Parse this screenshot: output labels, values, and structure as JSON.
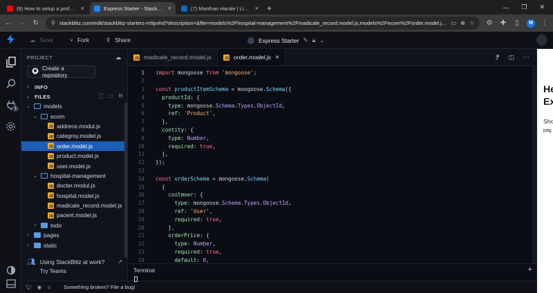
{
  "browser": {
    "tabs": [
      {
        "title": "(8) How to setup a professional",
        "favicon": "youtube-icon",
        "color": "#ff0000",
        "active": false
      },
      {
        "title": "Express Starter - StackBlitz",
        "favicon": "stackblitz-icon",
        "color": "#1389fd",
        "active": true
      },
      {
        "title": "(7) Manthan Harale | LinkedIn",
        "favicon": "linkedin-icon",
        "color": "#0a66c2",
        "active": false
      }
    ],
    "new_tab": "+",
    "url": "stackblitz.com/edit/stackblitz-starters-m9pvhd?description=&file=models%2Fhospital-management%2Fmadicale_record.model.js,models%2Fecom%2Forder.model.j...",
    "profile_initial": "M"
  },
  "header": {
    "save_label": "Save",
    "fork_label": "Fork",
    "share_label": "Share",
    "project_name": "Express Starter"
  },
  "sidebar": {
    "project_label": "PROJECT",
    "create_repo_label": "Create a repository",
    "info_label": "INFO",
    "files_label": "FILES",
    "tree": [
      {
        "label": "models",
        "type": "folder-open",
        "depth": 0
      },
      {
        "label": "ecom",
        "type": "folder-open",
        "depth": 1
      },
      {
        "label": "addrece.modul.js",
        "type": "file",
        "depth": 2
      },
      {
        "label": "categroy.model.js",
        "type": "file",
        "depth": 2
      },
      {
        "label": "order.model.js",
        "type": "file",
        "depth": 2,
        "selected": true
      },
      {
        "label": "product.model.js",
        "type": "file",
        "depth": 2
      },
      {
        "label": "user.model.js",
        "type": "file",
        "depth": 2
      },
      {
        "label": "hospital-management",
        "type": "folder-open",
        "depth": 1
      },
      {
        "label": "docter.modul.js",
        "type": "file",
        "depth": 2
      },
      {
        "label": "hospital.model.js",
        "type": "file",
        "depth": 2
      },
      {
        "label": "madicale_record.model.js",
        "type": "file",
        "depth": 2
      },
      {
        "label": "pacent.model.js",
        "type": "file",
        "depth": 2
      },
      {
        "label": "todo",
        "type": "folder-closed",
        "depth": 1
      },
      {
        "label": "pages",
        "type": "folder-closed",
        "depth": 0
      },
      {
        "label": "static",
        "type": "folder-closed",
        "depth": 0
      }
    ],
    "promo_line1": "Using StackBlitz at work?",
    "promo_line2": "Try Teams"
  },
  "activity": {
    "ports_badge": "1"
  },
  "status": {
    "broken_label": "Something broken? File a bug!"
  },
  "editor": {
    "tabs": [
      {
        "label": "madicale_record.model.js",
        "active": false
      },
      {
        "label": "order.model.js",
        "active": true
      }
    ],
    "js_badge": "JS",
    "lines": [
      [
        [
          "kw",
          "import"
        ],
        [
          "punc",
          " mongoose "
        ],
        [
          "kw",
          "from"
        ],
        [
          "punc",
          " "
        ],
        [
          "str",
          "'mongoose'"
        ],
        [
          "punc",
          ";"
        ]
      ],
      [],
      [
        [
          "kw",
          "const"
        ],
        [
          "punc",
          " "
        ],
        [
          "fn",
          "productItemSchema"
        ],
        [
          "punc",
          " = mongoose."
        ],
        [
          "fn",
          "Schema"
        ],
        [
          "punc",
          "({"
        ]
      ],
      [
        [
          "punc",
          "  "
        ],
        [
          "prop",
          "productId"
        ],
        [
          "punc",
          ": {"
        ]
      ],
      [
        [
          "punc",
          "    "
        ],
        [
          "prop",
          "type"
        ],
        [
          "punc",
          ": mongoose."
        ],
        [
          "ty",
          "Schema"
        ],
        [
          "punc",
          "."
        ],
        [
          "ty",
          "Types"
        ],
        [
          "punc",
          "."
        ],
        [
          "ty",
          "ObjectId"
        ],
        [
          "punc",
          ","
        ]
      ],
      [
        [
          "punc",
          "    "
        ],
        [
          "prop",
          "ref"
        ],
        [
          "punc",
          ": "
        ],
        [
          "str",
          "'Product'"
        ],
        [
          "punc",
          ","
        ]
      ],
      [
        [
          "punc",
          "  },"
        ]
      ],
      [
        [
          "punc",
          "  "
        ],
        [
          "prop",
          "contity"
        ],
        [
          "punc",
          ": {"
        ]
      ],
      [
        [
          "punc",
          "    "
        ],
        [
          "prop",
          "type"
        ],
        [
          "punc",
          ": "
        ],
        [
          "ty",
          "Number"
        ],
        [
          "punc",
          ","
        ]
      ],
      [
        [
          "punc",
          "    "
        ],
        [
          "prop",
          "required"
        ],
        [
          "punc",
          ": "
        ],
        [
          "kw",
          "true"
        ],
        [
          "punc",
          ","
        ]
      ],
      [
        [
          "punc",
          "  },"
        ]
      ],
      [
        [
          "punc",
          "});"
        ]
      ],
      [],
      [
        [
          "kw",
          "const"
        ],
        [
          "punc",
          " "
        ],
        [
          "fn",
          "orderSchema"
        ],
        [
          "punc",
          " = mongoose."
        ],
        [
          "fn",
          "Schema"
        ],
        [
          "punc",
          "("
        ]
      ],
      [
        [
          "punc",
          "  {"
        ]
      ],
      [
        [
          "punc",
          "    "
        ],
        [
          "prop",
          "costmoer"
        ],
        [
          "punc",
          ": {"
        ]
      ],
      [
        [
          "punc",
          "      "
        ],
        [
          "prop",
          "type"
        ],
        [
          "punc",
          ": mongoose."
        ],
        [
          "ty",
          "Schema"
        ],
        [
          "punc",
          "."
        ],
        [
          "ty",
          "Types"
        ],
        [
          "punc",
          "."
        ],
        [
          "ty",
          "ObjectId"
        ],
        [
          "punc",
          ","
        ]
      ],
      [
        [
          "punc",
          "      "
        ],
        [
          "prop",
          "ref"
        ],
        [
          "punc",
          ": "
        ],
        [
          "str",
          "'User'"
        ],
        [
          "punc",
          ","
        ]
      ],
      [
        [
          "punc",
          "      "
        ],
        [
          "prop",
          "required"
        ],
        [
          "punc",
          ": "
        ],
        [
          "kw",
          "true"
        ],
        [
          "punc",
          ","
        ]
      ],
      [
        [
          "punc",
          "    },"
        ]
      ],
      [
        [
          "punc",
          "    "
        ],
        [
          "prop",
          "orderPrice"
        ],
        [
          "punc",
          ": {"
        ]
      ],
      [
        [
          "punc",
          "      "
        ],
        [
          "prop",
          "type"
        ],
        [
          "punc",
          ": "
        ],
        [
          "ty",
          "Number"
        ],
        [
          "punc",
          ","
        ]
      ],
      [
        [
          "punc",
          "      "
        ],
        [
          "prop",
          "required"
        ],
        [
          "punc",
          ": "
        ],
        [
          "kw",
          "true"
        ],
        [
          "punc",
          ","
        ]
      ],
      [
        [
          "punc",
          "      "
        ],
        [
          "prop",
          "default"
        ],
        [
          "punc",
          ": "
        ],
        [
          "ty",
          "0"
        ],
        [
          "punc",
          ","
        ]
      ],
      [
        [
          "punc",
          "    },"
        ]
      ]
    ]
  },
  "terminal": {
    "title": "Terminal"
  },
  "preview": {
    "heading": "He\nEx",
    "text1": "Sho",
    "text2": "pag"
  }
}
